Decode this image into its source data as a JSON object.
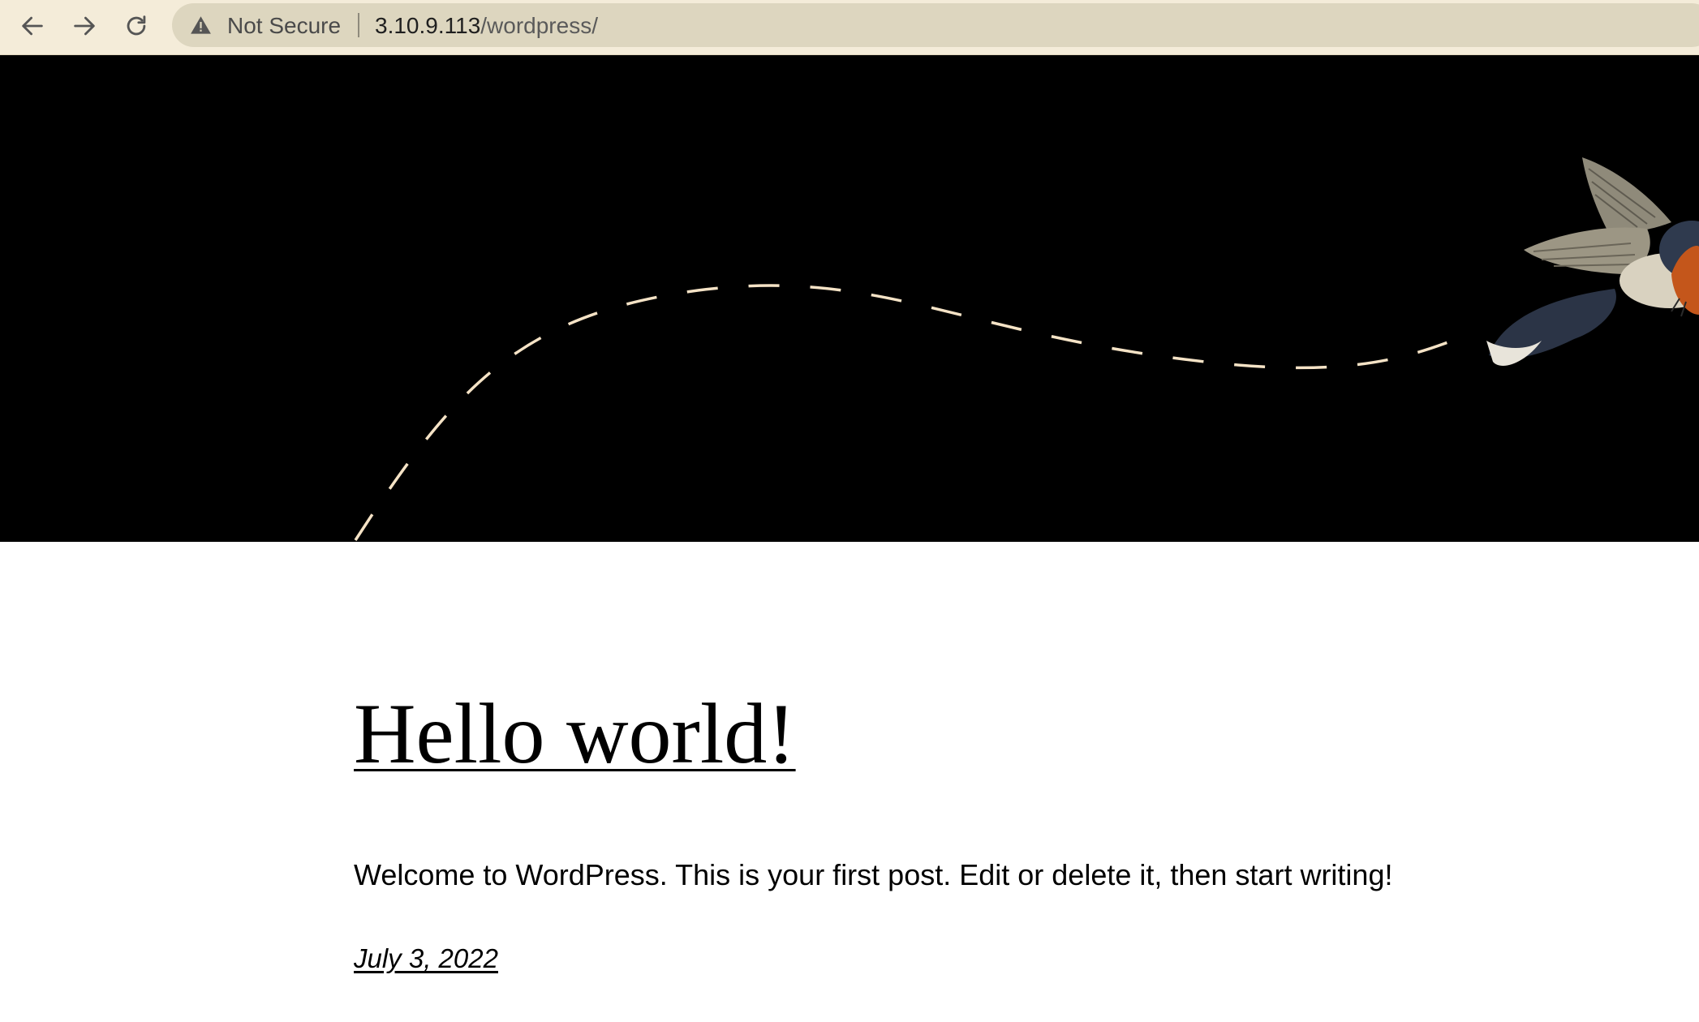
{
  "browser": {
    "security_label": "Not Secure",
    "url_host": "3.10.9.113",
    "url_path": "/wordpress/"
  },
  "colors": {
    "toolbar_bg": "#f4ecd9",
    "omnibox_bg": "#ddd6bf",
    "hero_bg": "#000000",
    "flight_path": "#f5e3c6"
  },
  "post": {
    "title": "Hello world!",
    "excerpt": "Welcome to WordPress. This is your first post. Edit or delete it, then start writing!",
    "date": "July 3, 2022"
  }
}
